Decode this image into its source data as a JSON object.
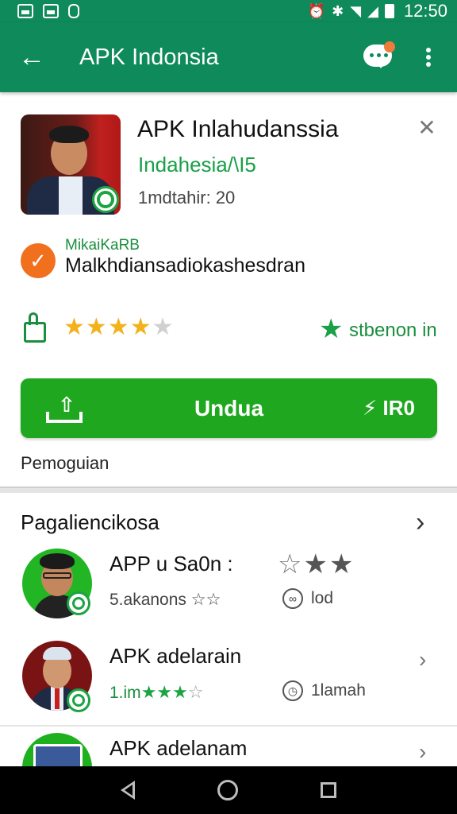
{
  "status_bar": {
    "time": "12:50",
    "icons": [
      "gallery-icon",
      "image-icon",
      "sim-icon",
      "alarm-icon",
      "bluetooth-icon",
      "wifi-icon",
      "signal-icon",
      "battery-icon"
    ]
  },
  "app_bar": {
    "title": "APK Indonsia",
    "back_icon": "arrow-left-icon",
    "chat_icon": "chat-bubble-icon",
    "menu_icon": "more-vert-icon",
    "color": "#0f8a5a"
  },
  "app": {
    "name": "APK Inlahudanssia",
    "subtitle": "Indahesia/\\I5",
    "info": "1mdtahir: 20",
    "collapse_icon": "chevron-collapse-icon"
  },
  "developer": {
    "label": "MikaiKaRB",
    "description": "Malkhdiansadiokashesdran",
    "icon": "check-circle-icon"
  },
  "rating": {
    "value": 4,
    "out_of": 5,
    "star_glyph": "★",
    "recommend_text": "stbenon in",
    "like_icon": "thumb-up-icon"
  },
  "install": {
    "label": "Undua",
    "price": "⚡ IR0",
    "icon": "upload-icon",
    "color": "#1fa81f"
  },
  "progress_note": "Pemoguian",
  "related": {
    "title": "Pagaliencikosa",
    "arrow": "›",
    "items": [
      {
        "name": "APP u Sa0n :",
        "meta": "5.akanons ☆☆",
        "side": "lod",
        "side_icon": "link-icon",
        "stars_top": "☆★★"
      },
      {
        "name": "APK adelarain",
        "meta": "1.im",
        "meta_stars": "★★★",
        "meta_stars_empty": "☆",
        "side": "1lamah",
        "side_icon": "clock-icon",
        "chevron": "›"
      },
      {
        "name": "APK adelanam",
        "chevron": "›"
      }
    ]
  },
  "nav": {
    "back": "nav-back-icon",
    "home": "nav-home-icon",
    "recents": "nav-recents-icon"
  }
}
